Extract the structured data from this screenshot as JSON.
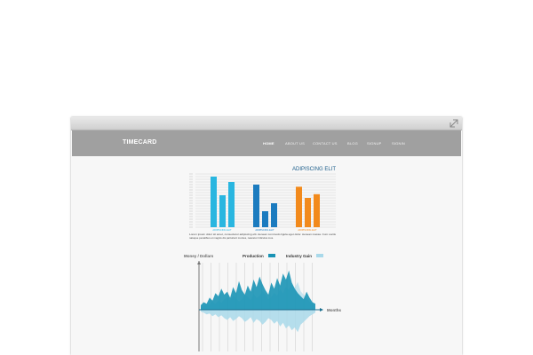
{
  "app": {
    "logo": "TIMECARD",
    "nav": [
      {
        "label": "HOME",
        "active": true
      },
      {
        "label": "ABOUT US",
        "active": false
      },
      {
        "label": "CONTACT US",
        "active": false
      },
      {
        "label": "BLOG",
        "active": false
      },
      {
        "label": "SIGNUP",
        "active": false
      },
      {
        "label": "SIGNIN",
        "active": false
      }
    ],
    "icons": {
      "window_control": "resize-icon"
    }
  },
  "colors": {
    "bar_cyan": "#29b6e0",
    "bar_blue": "#1b7bbf",
    "bar_orange": "#f28a1c",
    "area_primary": "#1a93b5",
    "area_secondary": "#a9d9ea",
    "navbar": "#a0a0a0"
  },
  "chart_data": [
    {
      "type": "bar",
      "title": "ADIPISCING ELIT",
      "categories": [
        "ADIPISCING ELIT",
        "ADIPISCING ELIT",
        "ADIPISCING ELIT"
      ],
      "series_colors": [
        "#29b6e0",
        "#1b7bbf",
        "#f28a1c"
      ],
      "groups": [
        {
          "label": "ADIPISCING ELIT",
          "values": [
            95,
            60,
            85
          ]
        },
        {
          "label": "ADIPISCING ELIT",
          "values": [
            80,
            30,
            45
          ]
        },
        {
          "label": "ADIPISCING ELIT",
          "values": [
            76,
            55,
            62
          ]
        }
      ],
      "ylim": [
        0,
        100
      ],
      "grid": true,
      "caption_lines": [
        "Lorem ipsum dolor sit amet, consectetur adipiscing elit. Aenean commodo ligula eget dolor. Aenean massa. Cum sociis",
        "natoque penatibus et magnis dis parturient montes, nascetur ridiculus mus."
      ]
    },
    {
      "type": "area",
      "ylabel": "Money / Dollars",
      "xlabel": "Months",
      "legend_position": "top",
      "series": [
        {
          "name": "Production",
          "color": "#1a93b5",
          "values": [
            3,
            5,
            4,
            8,
            6,
            11,
            9,
            14,
            10,
            12,
            8,
            15,
            11,
            19,
            13,
            10,
            16,
            12,
            20,
            15,
            22,
            17,
            13,
            10,
            18,
            14,
            21,
            16,
            24,
            20,
            26,
            18,
            14,
            11,
            9,
            7,
            12,
            8,
            5,
            4
          ]
        },
        {
          "name": "Industry Gain",
          "color": "#a9d9ea",
          "values": [
            2,
            3,
            5,
            4,
            7,
            5,
            8,
            6,
            9,
            11,
            8,
            12,
            10,
            7,
            9,
            13,
            11,
            8,
            14,
            10,
            12,
            16,
            13,
            9,
            11,
            15,
            12,
            18,
            14,
            20,
            17,
            22,
            19,
            24,
            16,
            13,
            10,
            7,
            5,
            3
          ]
        }
      ],
      "grid": true
    }
  ]
}
